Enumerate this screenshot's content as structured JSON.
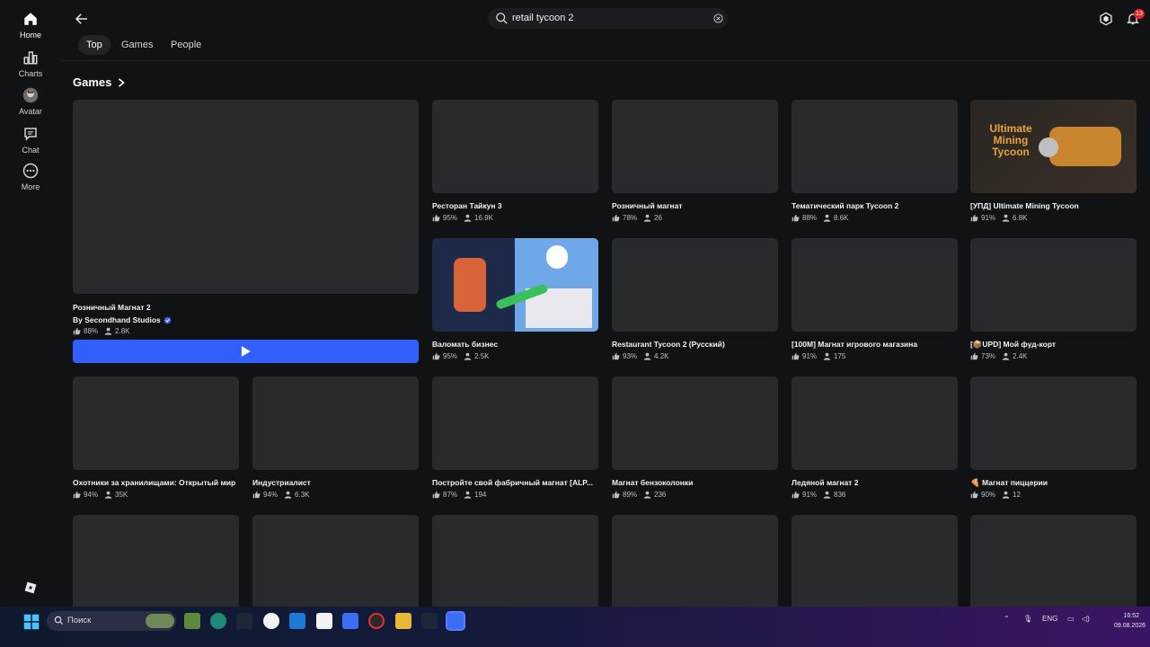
{
  "nav": {
    "items": [
      {
        "label": "Home",
        "icon": "home-icon"
      },
      {
        "label": "Charts",
        "icon": "charts-icon"
      },
      {
        "label": "Avatar",
        "icon": "avatar-icon"
      },
      {
        "label": "Chat",
        "icon": "chat-icon"
      },
      {
        "label": "More",
        "icon": "more-icon"
      }
    ]
  },
  "header": {
    "search_value": "retail tycoon 2",
    "notifications_count": "13",
    "tabs": [
      "Top",
      "Games",
      "People"
    ]
  },
  "section": {
    "title": "Games"
  },
  "featured": {
    "title": "Розничный Магнат 2",
    "by": "By Secondhand Studios",
    "rating": "88%",
    "players": "2.8K"
  },
  "games": [
    {
      "title": "Ресторан Тайкун 3",
      "rating": "95%",
      "players": "16.9K"
    },
    {
      "title": "Розничный магнат",
      "rating": "78%",
      "players": "26"
    },
    {
      "title": "Тематический парк Tycoon 2",
      "rating": "88%",
      "players": "8.6K"
    },
    {
      "title": "[УПД] Ultimate Mining Tycoon",
      "rating": "91%",
      "players": "6.8K"
    },
    {
      "title": "Валомать бизнес",
      "rating": "95%",
      "players": "2.5K"
    },
    {
      "title": "Restaurant Tycoon 2 (Русский)",
      "rating": "93%",
      "players": "4.2K"
    },
    {
      "title": "[100M] Магнат игрового магазина",
      "rating": "91%",
      "players": "175"
    },
    {
      "title": "[📦UPD] Мой фуд-корт",
      "rating": "73%",
      "players": "2.4K"
    },
    {
      "title": "Охотники за хранилищами: Открытый мир",
      "rating": "94%",
      "players": "35K"
    },
    {
      "title": "Индустриалист",
      "rating": "94%",
      "players": "6.3K"
    },
    {
      "title": "Постройте свой фабричный магнат [ALP...",
      "rating": "87%",
      "players": "194"
    },
    {
      "title": "Магнат бензоколонки",
      "rating": "89%",
      "players": "236"
    },
    {
      "title": "Ледяной магнат 2",
      "rating": "91%",
      "players": "836"
    },
    {
      "title": "🍕 Магнат пиццерии",
      "rating": "90%",
      "players": "12"
    }
  ],
  "thumb_art": {
    "mining_text": "Ultimate Mining Tycoon"
  },
  "taskbar": {
    "search_label": "Поиск",
    "lang": "ENG",
    "time": "16:52",
    "date": "09.08.2026"
  },
  "colors": {
    "accent": "#335fff",
    "background": "#111214",
    "tile": "#292a2e",
    "badge": "#e0242a"
  }
}
